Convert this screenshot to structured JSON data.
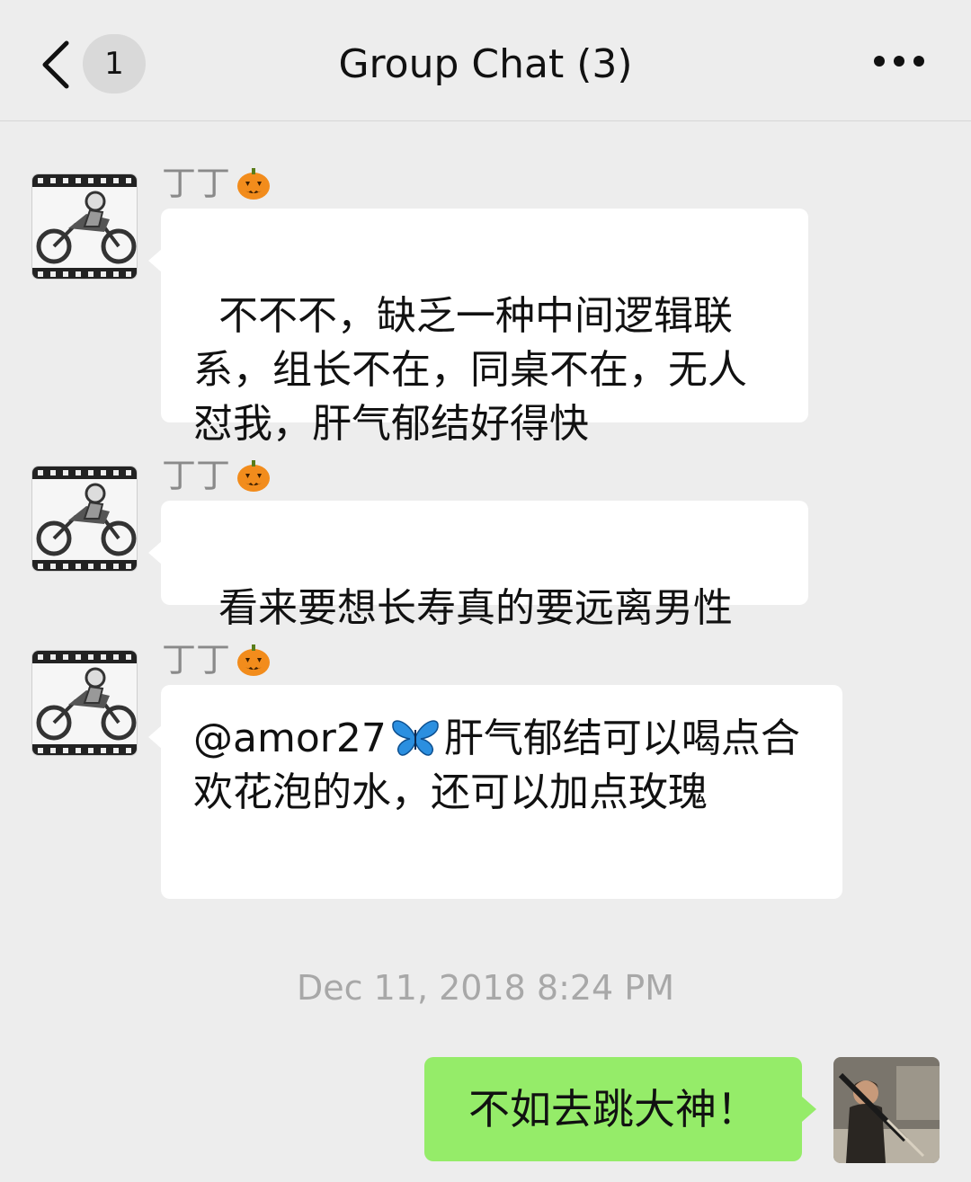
{
  "header": {
    "unread_count": "1",
    "title": "Group Chat (3)",
    "back_icon": "chevron-left-icon",
    "more_icon": "more-dots-icon"
  },
  "messages": [
    {
      "sender": "丁丁",
      "sender_emoji": "pumpkin-icon",
      "text": "不不不，缺乏一种中间逻辑联系，组长不在，同桌不在，无人怼我，肝气郁结好得快"
    },
    {
      "sender": "丁丁",
      "sender_emoji": "pumpkin-icon",
      "text": "看来要想长寿真的要远离男性"
    },
    {
      "sender": "丁丁",
      "sender_emoji": "pumpkin-icon",
      "mention": "@amor27",
      "mention_emoji": "butterfly-icon",
      "text": "肝气郁结可以喝点合欢花泡的水，还可以加点玫瑰"
    }
  ],
  "timestamp": "Dec 11, 2018 8:24 PM",
  "outgoing": {
    "text": "不如去跳大神！"
  },
  "colors": {
    "background": "#ededed",
    "incoming_bubble": "#ffffff",
    "outgoing_bubble": "#95ec69",
    "timestamp_text": "#a8a8a8",
    "sender_text": "#8a8a8a"
  }
}
